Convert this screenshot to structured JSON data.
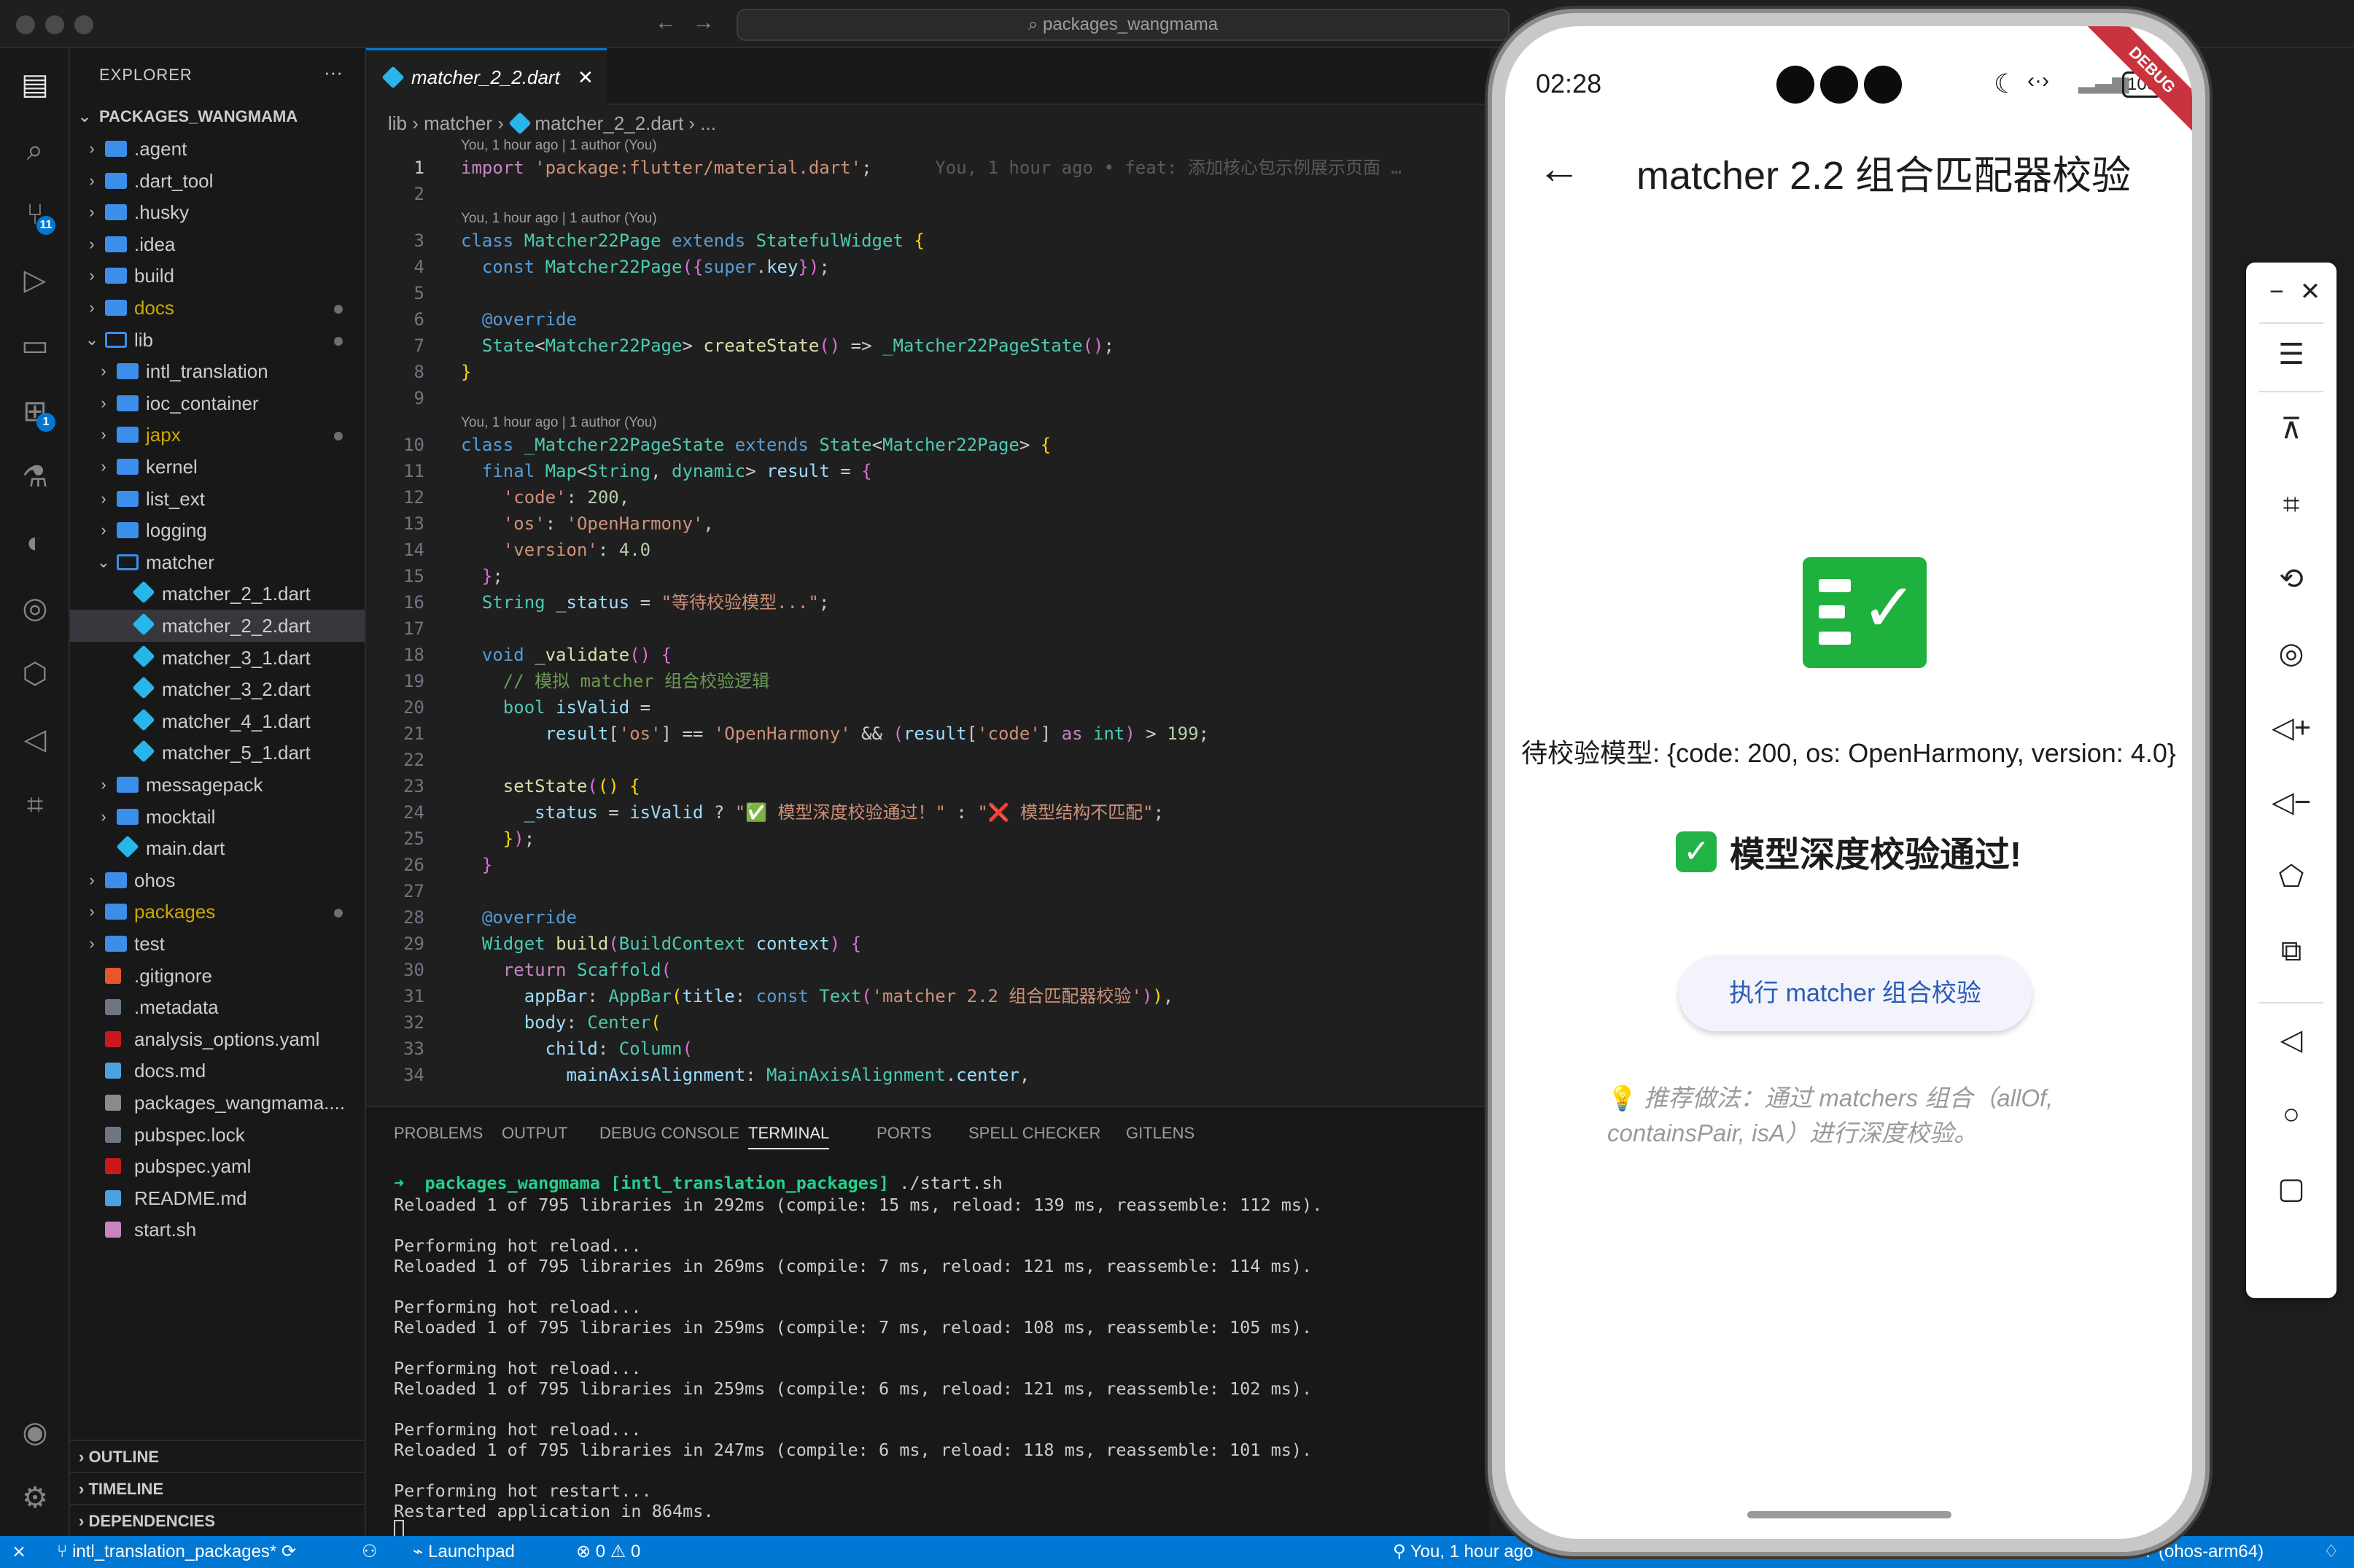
{
  "titlebar": {
    "search_text": "packages_wangmama",
    "back": "←",
    "forward": "→"
  },
  "activity": {
    "scm_badge": "11",
    "extensions_badge": "1"
  },
  "explorer": {
    "title": "EXPLORER",
    "more": "···",
    "root": "PACKAGES_WANGMAMA",
    "items": [
      {
        "label": ".agent",
        "kind": "folder",
        "depth": 0,
        "chev": "›"
      },
      {
        "label": ".dart_tool",
        "kind": "folder",
        "depth": 0,
        "chev": "›"
      },
      {
        "label": ".husky",
        "kind": "folder",
        "depth": 0,
        "chev": "›"
      },
      {
        "label": ".idea",
        "kind": "folder",
        "depth": 0,
        "chev": "›"
      },
      {
        "label": "build",
        "kind": "folder",
        "depth": 0,
        "chev": "›"
      },
      {
        "label": "docs",
        "kind": "folder",
        "depth": 0,
        "chev": "›",
        "dot": true
      },
      {
        "label": "lib",
        "kind": "folder-open",
        "depth": 0,
        "chev": "⌄",
        "dot": true
      },
      {
        "label": "intl_translation",
        "kind": "folder",
        "depth": 1,
        "chev": "›"
      },
      {
        "label": "ioc_container",
        "kind": "folder",
        "depth": 1,
        "chev": "›"
      },
      {
        "label": "japx",
        "kind": "folder",
        "depth": 1,
        "chev": "›",
        "dot": true
      },
      {
        "label": "kernel",
        "kind": "folder",
        "depth": 1,
        "chev": "›"
      },
      {
        "label": "list_ext",
        "kind": "folder",
        "depth": 1,
        "chev": "›"
      },
      {
        "label": "logging",
        "kind": "folder",
        "depth": 1,
        "chev": "›"
      },
      {
        "label": "matcher",
        "kind": "folder-open",
        "depth": 1,
        "chev": "⌄"
      },
      {
        "label": "matcher_2_1.dart",
        "kind": "dart",
        "depth": 2
      },
      {
        "label": "matcher_2_2.dart",
        "kind": "dart",
        "depth": 2,
        "selected": true
      },
      {
        "label": "matcher_3_1.dart",
        "kind": "dart",
        "depth": 2
      },
      {
        "label": "matcher_3_2.dart",
        "kind": "dart",
        "depth": 2
      },
      {
        "label": "matcher_4_1.dart",
        "kind": "dart",
        "depth": 2
      },
      {
        "label": "matcher_5_1.dart",
        "kind": "dart",
        "depth": 2
      },
      {
        "label": "messagepack",
        "kind": "folder",
        "depth": 1,
        "chev": "›"
      },
      {
        "label": "mocktail",
        "kind": "folder",
        "depth": 1,
        "chev": "›"
      },
      {
        "label": "main.dart",
        "kind": "dart",
        "depth": 1
      },
      {
        "label": "ohos",
        "kind": "folder",
        "depth": 0,
        "chev": "›"
      },
      {
        "label": "packages",
        "kind": "folder",
        "depth": 0,
        "chev": "›",
        "dot": true
      },
      {
        "label": "test",
        "kind": "folder",
        "depth": 0,
        "chev": "›"
      },
      {
        "label": ".gitignore",
        "kind": "git",
        "depth": 0
      },
      {
        "label": ".metadata",
        "kind": "file",
        "depth": 0
      },
      {
        "label": "analysis_options.yaml",
        "kind": "yaml",
        "depth": 0
      },
      {
        "label": "docs.md",
        "kind": "md",
        "depth": 0
      },
      {
        "label": "packages_wangmama....",
        "kind": "code",
        "depth": 0
      },
      {
        "label": "pubspec.lock",
        "kind": "file",
        "depth": 0
      },
      {
        "label": "pubspec.yaml",
        "kind": "yaml",
        "depth": 0
      },
      {
        "label": "README.md",
        "kind": "md",
        "depth": 0
      },
      {
        "label": "start.sh",
        "kind": "sh",
        "depth": 0
      }
    ],
    "sections": [
      "OUTLINE",
      "TIMELINE",
      "DEPENDENCIES"
    ]
  },
  "editor": {
    "tab_label": "matcher_2_2.dart",
    "tab_close": "✕",
    "breadcrumb": [
      "lib",
      "matcher",
      "matcher_2_2.dart",
      "..."
    ],
    "lens": "You, 1 hour ago | 1 author (You)",
    "inline_blame": "You, 1 hour ago • feat: 添加核心包示例展示页面 …"
  },
  "panel": {
    "tabs": [
      "PROBLEMS",
      "OUTPUT",
      "DEBUG CONSOLE",
      "TERMINAL",
      "PORTS",
      "SPELL CHECKER",
      "GITLENS"
    ],
    "active_tab": "TERMINAL",
    "prompt_path": "packages_wangmama [intl_translation_packages]",
    "prompt_cmd": "./start.sh",
    "lines": [
      "Reloaded 1 of 795 libraries in 292ms (compile: 15 ms, reload: 139 ms, reassemble: 112 ms).",
      "",
      "Performing hot reload...",
      "Reloaded 1 of 795 libraries in 269ms (compile: 7 ms, reload: 121 ms, reassemble: 114 ms).",
      "",
      "Performing hot reload...",
      "Reloaded 1 of 795 libraries in 259ms (compile: 7 ms, reload: 108 ms, reassemble: 105 ms).",
      "",
      "Performing hot reload...",
      "Reloaded 1 of 795 libraries in 259ms (compile: 6 ms, reload: 121 ms, reassemble: 102 ms).",
      "",
      "Performing hot reload...",
      "Reloaded 1 of 795 libraries in 247ms (compile: 6 ms, reload: 118 ms, reassemble: 101 ms).",
      "",
      "Performing hot restart...",
      "Restarted application in 864ms."
    ]
  },
  "statusbar": {
    "branch": "intl_translation_packages*",
    "launchpad": "Launchpad",
    "errors": "0",
    "warnings": "0",
    "blame": "You, 1 hour ago",
    "device": "0057 (ohos-arm64)"
  },
  "phone": {
    "time": "02:28",
    "battery": "100",
    "debug_label": "DEBUG",
    "appbar_title": "matcher 2.2 组合匹配器校验",
    "model_text": "待校验模型: {code: 200, os: OpenHarmony, version: 4.0}",
    "result_text": "模型深度校验通过!",
    "button_label": "执行 matcher 组合校验",
    "tip_text": "推荐做法：通过 matchers 组合（allOf, containsPair, isA）进行深度校验。",
    "accent": "#1fb13e",
    "button_text_color": "#2a5bb8"
  },
  "emulator_toolbar": {
    "minimize": "−",
    "close": "✕"
  }
}
